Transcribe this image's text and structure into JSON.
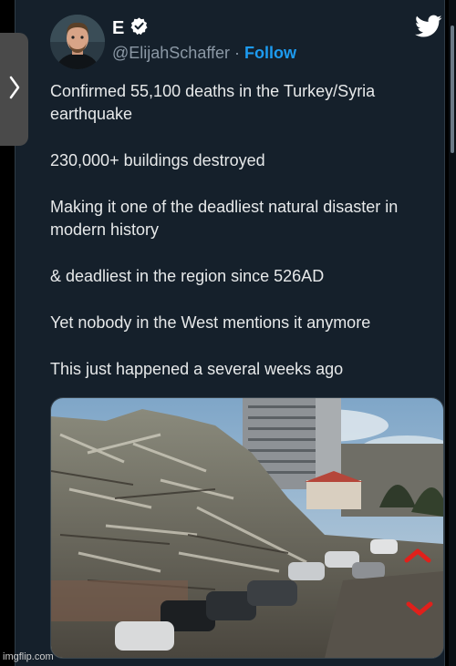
{
  "user": {
    "display_name": "E",
    "handle": "@ElijahSchaffer",
    "separator": "·",
    "follow_label": "Follow"
  },
  "tweet": {
    "paragraphs": [
      "Confirmed 55,100 deaths in the Turkey/Syria earthquake",
      "230,000+ buildings destroyed",
      "Making it one of the deadliest natural disaster in modern history",
      "& deadliest in the region since 526AD",
      "Yet nobody in the West mentions it anymore",
      "This just happened a several weeks ago"
    ]
  },
  "icons": {
    "twitter": "twitter-bird-icon",
    "verified": "verified-badge-icon",
    "side_tab": "chevron-right-icon"
  },
  "watermark": "imgflip.com",
  "colors": {
    "background": "#15202b",
    "accent": "#1d9bf0",
    "secondary_text": "#8b98a5",
    "primary_text": "#e7e9ea",
    "annotation_arrow": "#e0201b"
  }
}
